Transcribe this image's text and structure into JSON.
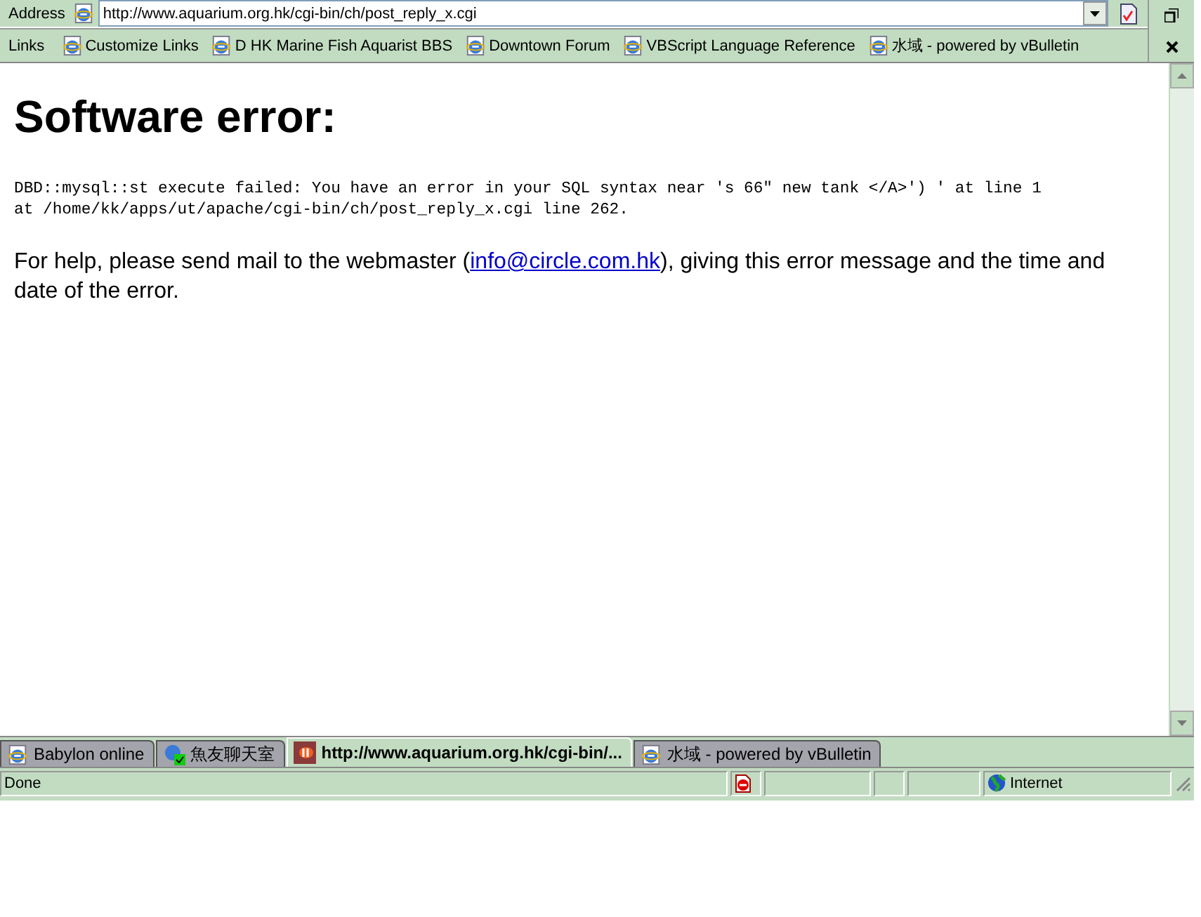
{
  "address_bar": {
    "label": "Address",
    "url": "http://www.aquarium.org.hk/cgi-bin/ch/post_reply_x.cgi"
  },
  "links_bar": {
    "label": "Links",
    "items": [
      {
        "label": "Customize Links"
      },
      {
        "label": "D HK Marine Fish Aquarist BBS"
      },
      {
        "label": "Downtown Forum"
      },
      {
        "label": "VBScript Language Reference"
      },
      {
        "label": "水域 - powered by vBulletin"
      }
    ]
  },
  "page": {
    "heading": "Software error:",
    "error_lines": [
      "DBD::mysql::st execute failed: You have an error in your SQL syntax near 's 66\" new tank </A>') ' at line 1",
      "at /home/kk/apps/ut/apache/cgi-bin/ch/post_reply_x.cgi line 262."
    ],
    "help_before": "For help, please send mail to the webmaster (",
    "help_link": "info@circle.com.hk",
    "help_after": "), giving this error message and the time and date of the error."
  },
  "tabs": [
    {
      "label": "Babylon online",
      "selected": false,
      "kind": "ie"
    },
    {
      "label": "魚友聊天室",
      "selected": false,
      "kind": "chat"
    },
    {
      "label": "http://www.aquarium.org.hk/cgi-bin/...",
      "selected": true,
      "kind": "fish"
    },
    {
      "label": "水域 - powered by vBulletin",
      "selected": false,
      "kind": "ie"
    }
  ],
  "status_bar": {
    "text": "Done",
    "zone": "Internet"
  }
}
